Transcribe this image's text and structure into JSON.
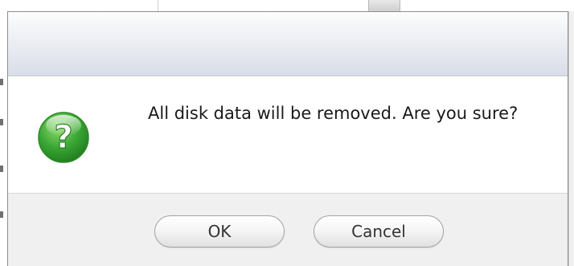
{
  "dialog": {
    "title": "",
    "message": "All disk data will be removed. Are you sure?",
    "icon": "question-icon",
    "buttons": {
      "ok_label": "OK",
      "cancel_label": "Cancel"
    }
  },
  "colors": {
    "icon_green": "#3aa635",
    "title_bar_gradient_end": "#d9dde7",
    "footer_background": "#f0f0f0",
    "border": "#8f8f8f"
  }
}
